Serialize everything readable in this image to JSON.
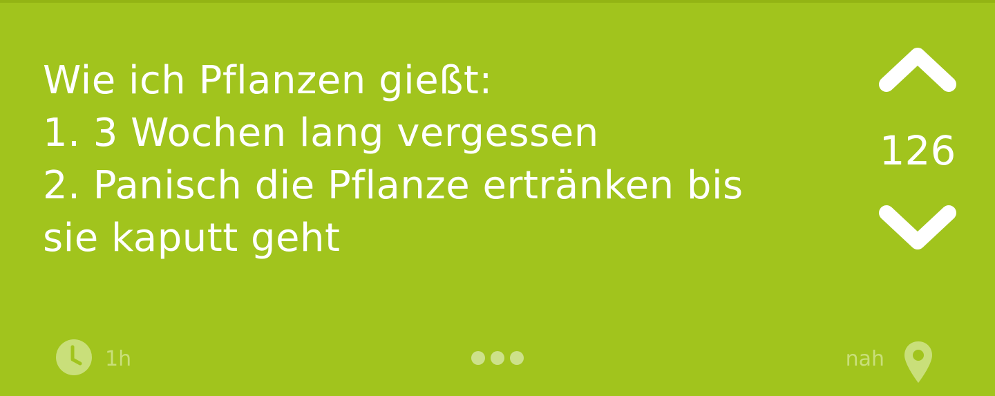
{
  "post": {
    "lines": [
      "Wie ich Pflanzen gießt:",
      "1. 3 Wochen lang vergessen",
      "2. Panisch die Pflanze ertränken bis",
      "sie kaputt geht"
    ]
  },
  "vote": {
    "count": "126",
    "up_icon": "chevron-up-icon",
    "down_icon": "chevron-down-icon"
  },
  "footer": {
    "time": "1h",
    "time_icon": "clock-icon",
    "more_icon": "more-dots-icon",
    "location": "nah",
    "location_icon": "map-pin-icon"
  },
  "colors": {
    "background": "#a1c41d",
    "text": "#ffffff",
    "muted": "#c9df7a"
  }
}
